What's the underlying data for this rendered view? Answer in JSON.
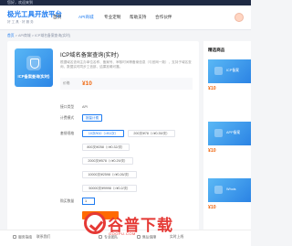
{
  "topbar": {
    "welcome": "您好，欢迎来到"
  },
  "header": {
    "logo_title": "极光工具开放平台",
    "logo_sub": "好工具·好服务",
    "nav": [
      "首页",
      "API商城",
      "专业定制",
      "帮助支持",
      "合作伙伴"
    ]
  },
  "breadcrumb": {
    "home": "首页",
    "sep1": ">",
    "category": "API商城",
    "sep2": ">",
    "current": "ICP域名备案查询(实时)"
  },
  "product": {
    "image_caption": "ICP备案查询(实时)",
    "title": "ICP域名备案查询(实时)",
    "description": "根据域名查询主办单位名称、备案号、审核时间等备案信息（与官网一致），支持子域名查询，数据实时同步工信部，结果准确可靠。",
    "price_label": "价格",
    "price": "¥10",
    "fields": {
      "api_type_label": "接口类型",
      "api_type": "API",
      "billing_label": "计费模式",
      "billing": "按量计费",
      "spec_label": "套餐规格",
      "quantity_label": "购买数量",
      "quantity": "1"
    },
    "specs": [
      {
        "label": "10次/¥10（≈¥1/次）",
        "selected": true
      },
      {
        "label": "200次/¥78（≈¥0.39/次）",
        "selected": false
      },
      {
        "label": "800次/¥258（≈¥0.32/次）",
        "selected": false
      },
      {
        "label": "2000次/¥578（≈¥0.29/次）",
        "selected": false
      },
      {
        "label": "10000次/¥2598（≈¥0.26/次）",
        "selected": false
      },
      {
        "label": "50000次/¥9998（≈¥0.2/次）",
        "selected": false
      }
    ]
  },
  "sidebar": {
    "heading": "精选商品",
    "cards": [
      {
        "name": "ICP备案",
        "price": "¥10"
      },
      {
        "name": "APP备案",
        "price": "¥10"
      },
      {
        "name": "Whois",
        "price": "¥10"
      }
    ]
  },
  "footer": {
    "links": [
      "服务指南",
      "联系我们",
      "专业团队",
      "售后保障",
      "实时上线"
    ]
  },
  "watermark": {
    "text": "谷普下载",
    "sub": "GOOPU.COM"
  },
  "colors": {
    "accent": "#1e7bf0",
    "price": "#f0670f",
    "buy": "#ff6a00",
    "watermark": "#e53935"
  }
}
